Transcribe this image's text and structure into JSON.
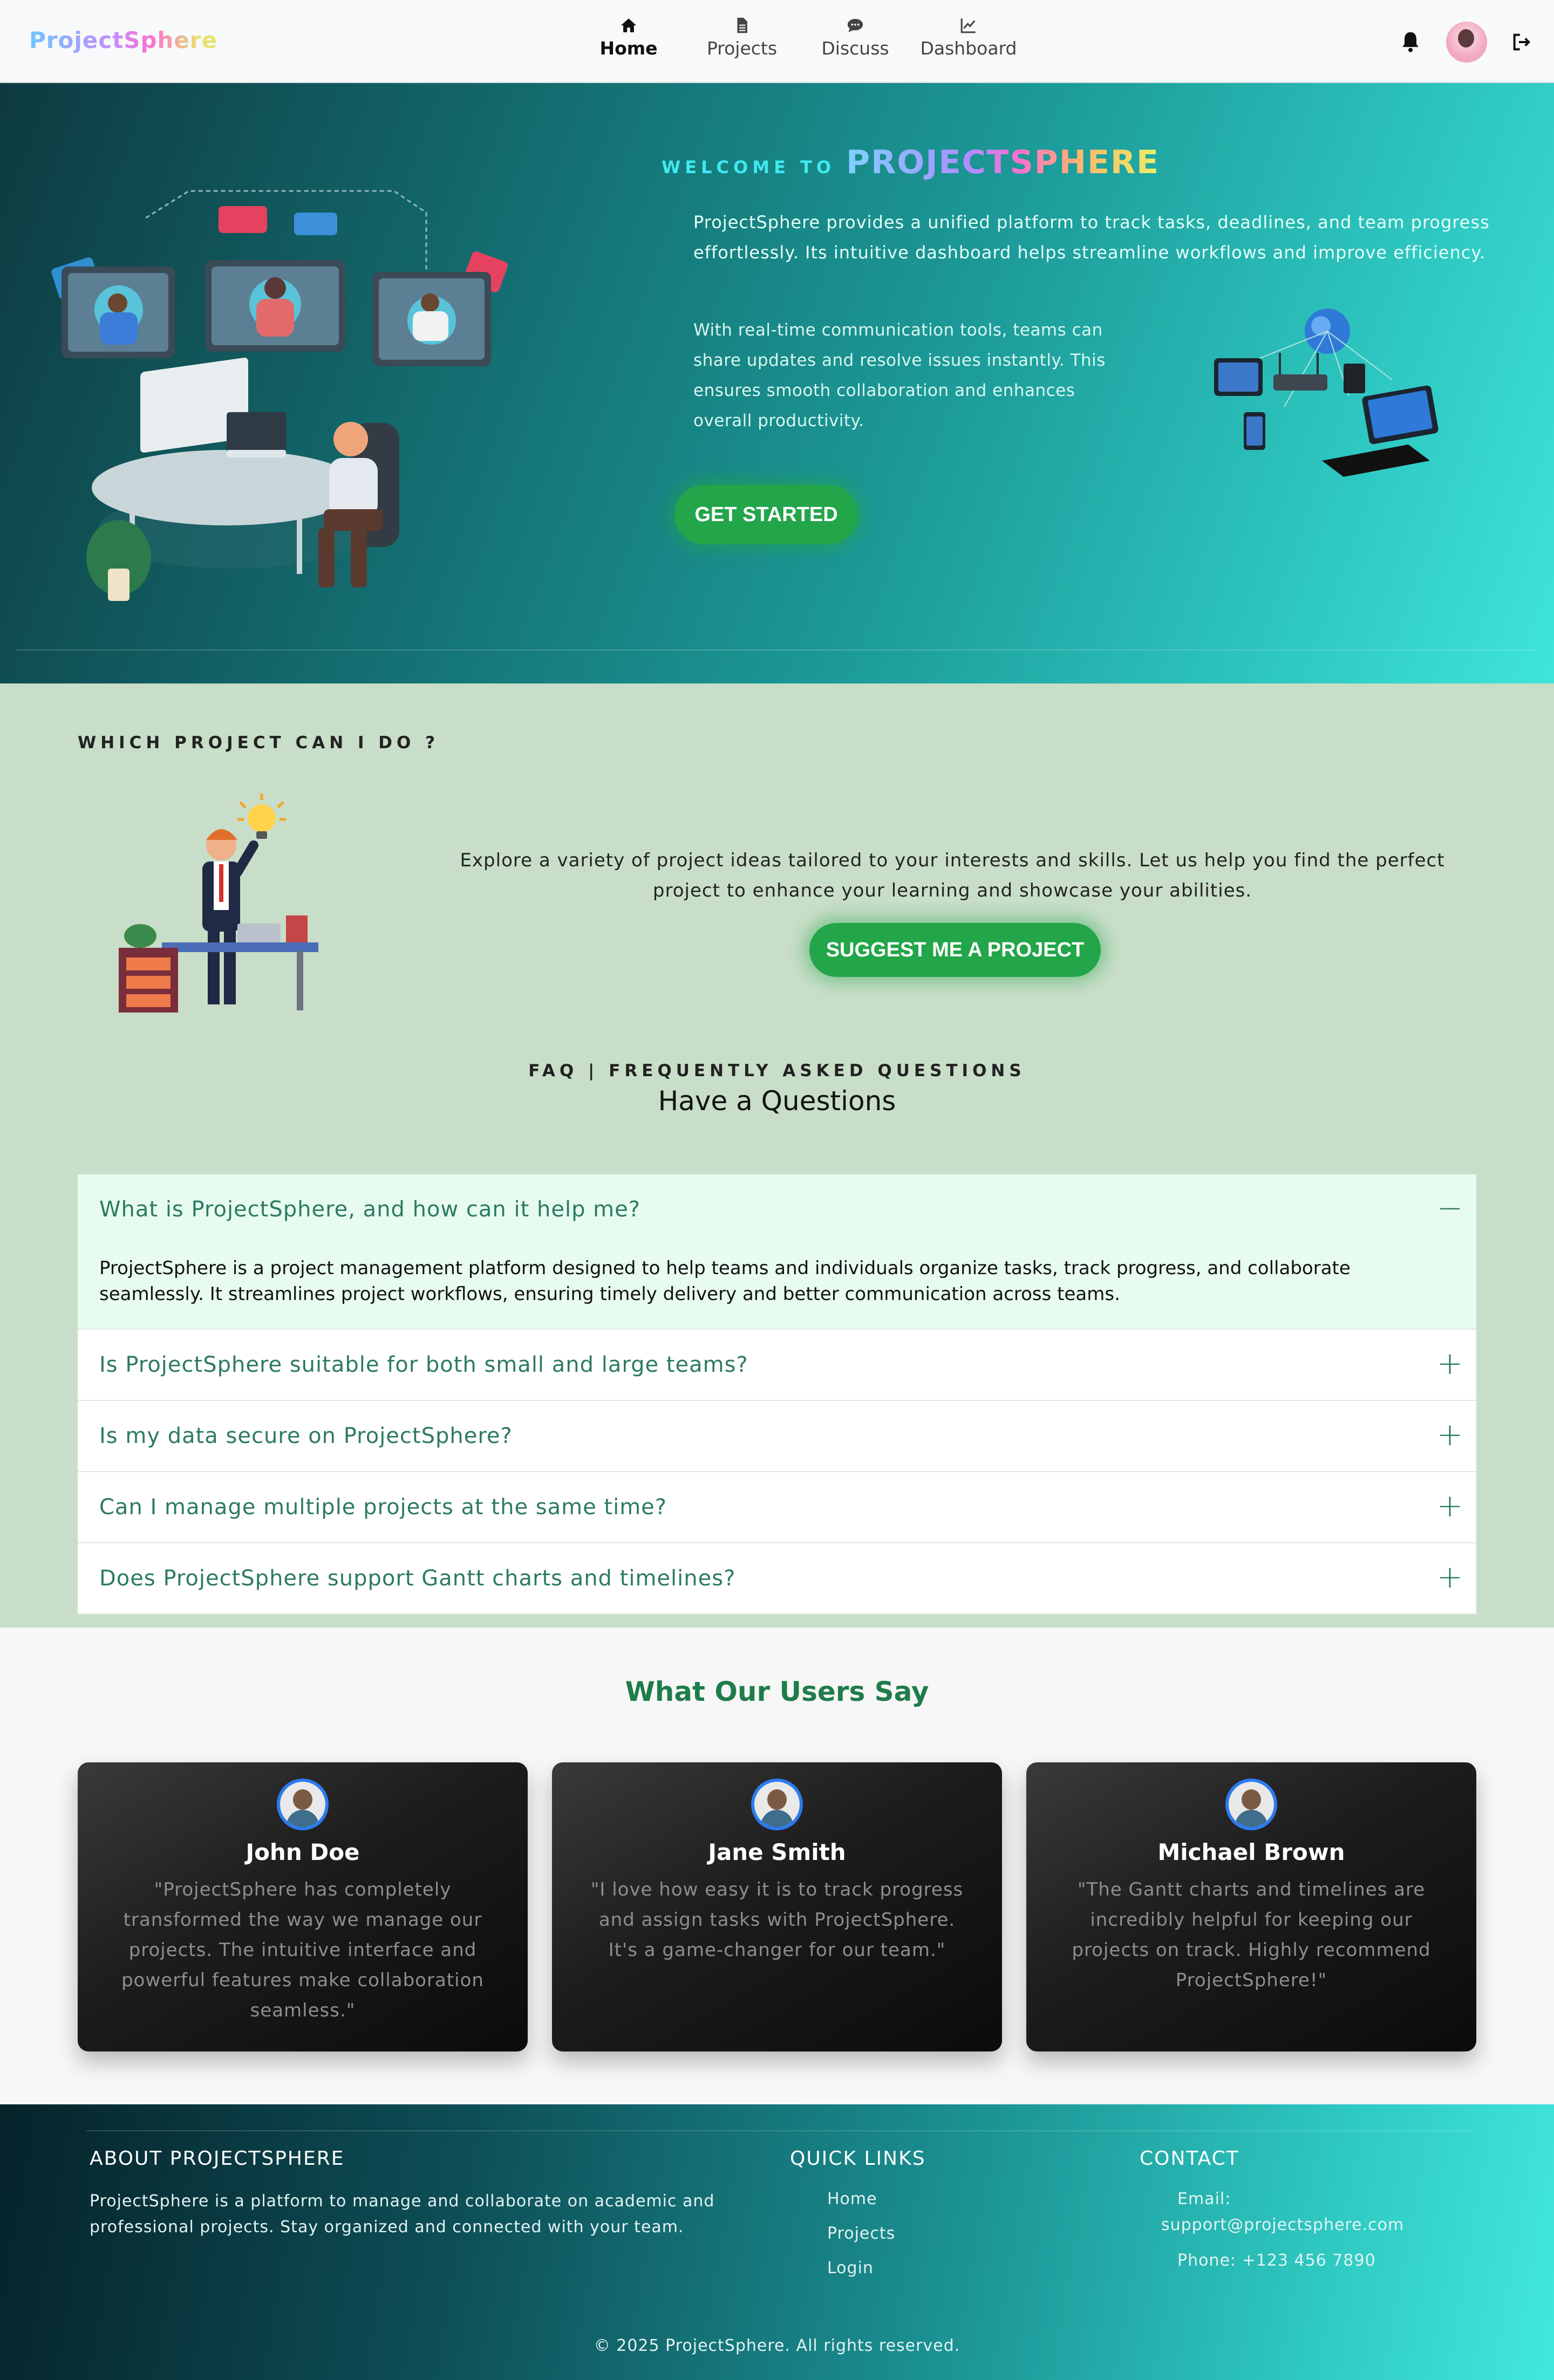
{
  "nav": {
    "brand": "ProjectSphere",
    "items": [
      {
        "label": "Home",
        "icon": "home-icon",
        "active": true
      },
      {
        "label": "Projects",
        "icon": "file-icon",
        "active": false
      },
      {
        "label": "Discuss",
        "icon": "chat-icon",
        "active": false
      },
      {
        "label": "Dashboard",
        "icon": "chart-line-icon",
        "active": false
      }
    ]
  },
  "hero": {
    "welcome_prefix": "WELCOME TO",
    "welcome_brand": "PROJECTSPHERE",
    "para1": "ProjectSphere provides a unified platform to track tasks, deadlines, and team progress effortlessly. Its intuitive dashboard helps streamline workflows and improve efficiency.",
    "para2": "With real-time communication tools, teams can share updates and resolve issues instantly. This ensures smooth collaboration and enhances overall productivity.",
    "cta": "GET STARTED"
  },
  "suggest": {
    "kicker": "WHICH PROJECT CAN I DO ?",
    "text": "Explore a variety of project ideas tailored to your interests and skills. Let us help you find the perfect project to enhance your learning and showcase your abilities.",
    "cta": "SUGGEST ME A PROJECT"
  },
  "faq": {
    "kicker": "FAQ | FREQUENTLY ASKED QUESTIONS",
    "title": "Have a Questions",
    "items": [
      {
        "q": "What is ProjectSphere, and how can it help me?",
        "a": "ProjectSphere is a project management platform designed to help teams and individuals organize tasks, track progress, and collaborate seamlessly. It streamlines project workflows, ensuring timely delivery and better communication across teams.",
        "toggle": "−"
      },
      {
        "q": "Is ProjectSphere suitable for both small and large teams?",
        "toggle": "+"
      },
      {
        "q": "Is my data secure on ProjectSphere?",
        "toggle": "+"
      },
      {
        "q": "Can I manage multiple projects at the same time?",
        "toggle": "+"
      },
      {
        "q": "Does ProjectSphere support Gantt charts and timelines?",
        "toggle": "+"
      }
    ]
  },
  "testimonials": {
    "title": "What Our Users Say",
    "items": [
      {
        "name": "John Doe",
        "quote": "\"ProjectSphere has completely transformed the way we manage our projects. The intuitive interface and powerful features make collaboration seamless.\""
      },
      {
        "name": "Jane Smith",
        "quote": "\"I love how easy it is to track progress and assign tasks with ProjectSphere. It's a game-changer for our team.\""
      },
      {
        "name": "Michael Brown",
        "quote": "\"The Gantt charts and timelines are incredibly helpful for keeping our projects on track. Highly recommend ProjectSphere!\""
      }
    ]
  },
  "footer": {
    "about_title": "ABOUT PROJECTSPHERE",
    "about_text": "ProjectSphere is a platform to manage and collaborate on academic and professional projects. Stay organized and connected with your team.",
    "links_title": "QUICK LINKS",
    "links": [
      "Home",
      "Projects",
      "Login"
    ],
    "contact_title": "CONTACT",
    "email_label": "Email:",
    "email": "support@projectsphere.com",
    "phone": "Phone: +123 456 7890",
    "copyright": "© 2025 ProjectSphere. All rights reserved."
  },
  "colors": {
    "accent_green": "#23a54a",
    "faq_text": "#2d7a63",
    "section_bg": "#c8dec8",
    "testimonial_title": "#1f7c4b"
  }
}
